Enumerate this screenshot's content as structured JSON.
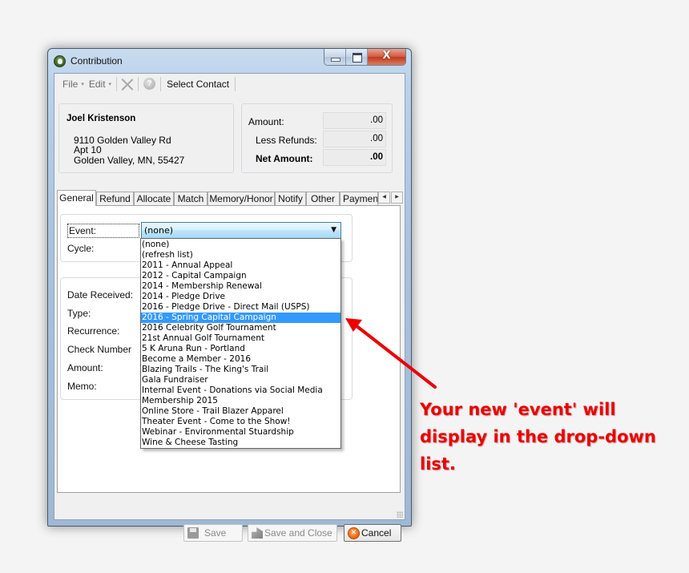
{
  "window": {
    "title": "Contribution",
    "close_glyph": "X"
  },
  "toolbar": {
    "file_label": "File",
    "edit_label": "Edit",
    "caret": "▾",
    "help_glyph": "?",
    "select_contact_label": "Select Contact"
  },
  "contact": {
    "name": "Joel Kristenson",
    "address_line1": "9110 Golden Valley Rd",
    "address_line2": "Apt 10",
    "address_line3": "Golden Valley, MN, 55427"
  },
  "totals": {
    "amount_label": "Amount:",
    "amount_value": ".00",
    "refunds_label": "Less Refunds:",
    "refunds_value": ".00",
    "net_label": "Net Amount:",
    "net_value": ".00"
  },
  "tabs": [
    {
      "label": "General",
      "active": true
    },
    {
      "label": "Refund"
    },
    {
      "label": "Allocate"
    },
    {
      "label": "Match"
    },
    {
      "label": "Memory/Honor"
    },
    {
      "label": "Notify"
    },
    {
      "label": "Other"
    },
    {
      "label": "Payment"
    }
  ],
  "tab_scroll": {
    "left": "◀",
    "right": "▶"
  },
  "general": {
    "event_label": "Event:",
    "cycle_label": "Cycle:",
    "event_value": "(none)",
    "combo_arrow": "▼",
    "fields": [
      "Date Received:",
      "Type:",
      "Recurrence:",
      "Check Number",
      "Amount:",
      "Memo:"
    ]
  },
  "event_dropdown": {
    "selected_index": 7,
    "options": [
      "(none)",
      "(refresh list)",
      "2011 - Annual Appeal",
      "2012 - Capital Campaign",
      "2014 - Membership Renewal",
      "2014 - Pledge Drive",
      "2016 - Pledge Drive - Direct Mail (USPS)",
      "2016 - Spring Capital Campaign",
      "2016 Celebrity Golf Tournament",
      "21st Annual Golf Tournament",
      "5 K Aruna Run - Portland",
      "Become a Member - 2016",
      "Blazing Trails - The King's Trail",
      "Gala Fundraiser",
      "Internal Event - Donations via Social Media",
      "Membership 2015",
      "Online Store - Trail Blazer Apparel",
      "Theater Event - Come to the Show!",
      "Webinar - Environmental Stuardship",
      "Wine & Cheese Tasting"
    ]
  },
  "buttons": {
    "save": "Save",
    "save_and_close": "Save and Close",
    "cancel": "Cancel",
    "cancel_glyph": "✕"
  },
  "annotation": {
    "text": "Your new 'event' will display in the drop-down list.",
    "color": "#ee0000"
  }
}
